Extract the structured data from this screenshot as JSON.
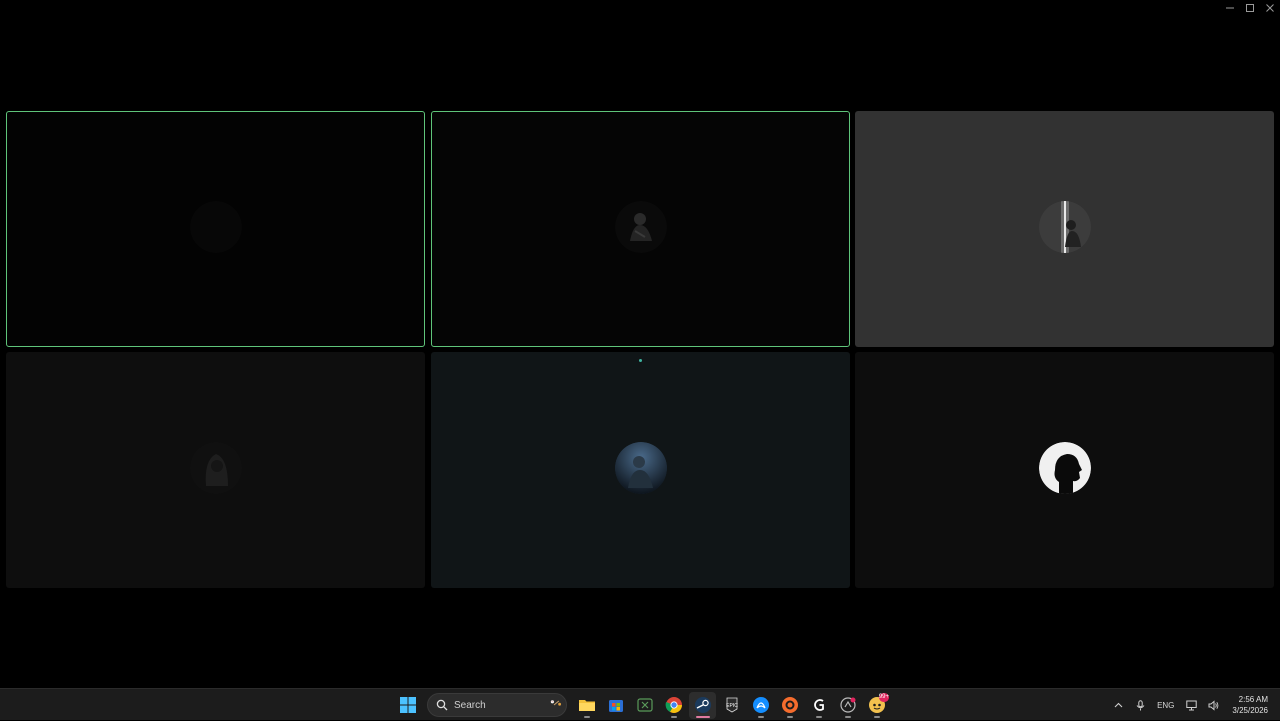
{
  "window": {
    "controls": [
      "minimize",
      "maximize",
      "close"
    ]
  },
  "tiles": [
    {
      "speaking": true,
      "bg": "#030303",
      "avatar": "dark-avatar"
    },
    {
      "speaking": true,
      "bg": "#050505",
      "avatar": "knight-avatar"
    },
    {
      "speaking": false,
      "bg": "#323232",
      "avatar": "spotlight-figure-avatar"
    },
    {
      "speaking": false,
      "bg": "#0e0e0e",
      "avatar": "hooded-figure-avatar"
    },
    {
      "speaking": false,
      "bg": "#101517",
      "avatar": "blue-warrior-avatar"
    },
    {
      "speaking": false,
      "bg": "#0d0d0d",
      "avatar": "silhouette-profile-avatar"
    }
  ],
  "colors": {
    "speaking_border": "#5fc47a",
    "taskbar": "#1c1c1c",
    "active_indicator": "#e07aa0"
  },
  "taskbar": {
    "search_label": "Search",
    "apps": [
      "file-explorer-icon",
      "microsoft-store-icon",
      "xbox-icon",
      "chrome-icon",
      "steam-icon",
      "epic-games-icon",
      "battlenet-icon",
      "origin-icon",
      "logitech-ghub-icon",
      "overwolf-icon",
      "discord-icon"
    ],
    "active_app": "steam-icon",
    "discord_badge": "99+"
  },
  "tray": {
    "language": "ENG",
    "time": "2:56 AM",
    "date": "3/25/2026"
  }
}
